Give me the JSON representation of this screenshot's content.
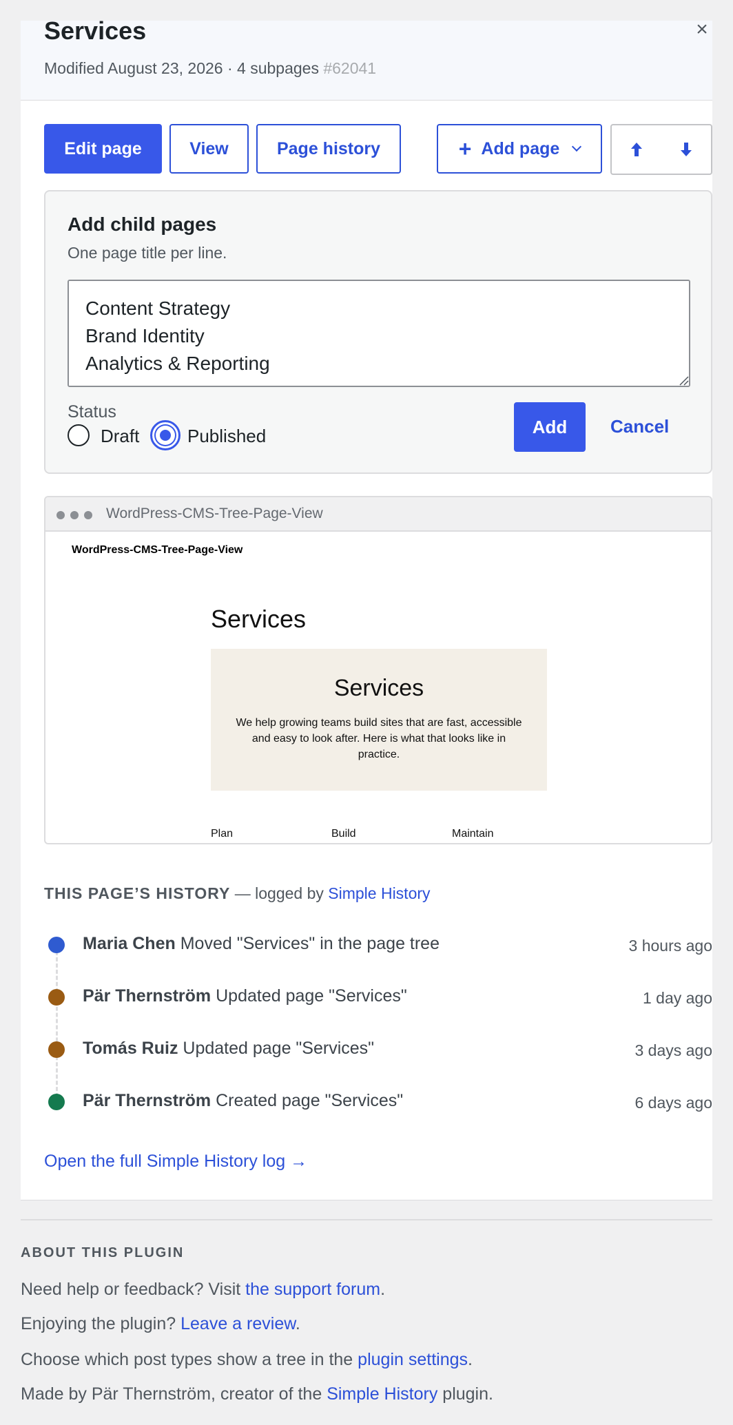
{
  "header": {
    "title": "Services",
    "meta": "Modified August 23, 2026 · 4 subpages",
    "page_id": "#62041",
    "close_glyph": "×"
  },
  "toolbar": {
    "edit_label": "Edit page",
    "view_label": "View",
    "history_label": "Page history",
    "add_plus": "+",
    "add_label": "Add page",
    "move_up_glyph": "🡅",
    "move_down_glyph": "🡇"
  },
  "add_child": {
    "title": "Add child pages",
    "hint": "One page title per line.",
    "textarea_value": "Content Strategy\nBrand Identity\nAnalytics & Reporting",
    "status_label": "Status",
    "options": [
      "Draft",
      "Published"
    ],
    "selected": "Published",
    "add_label": "Add",
    "cancel_label": "Cancel"
  },
  "preview": {
    "window_title": "WordPress-CMS-Tree-Page-View",
    "site_name": "WordPress-CMS-Tree-Page-View",
    "heading": "Services",
    "hero_title": "Services",
    "hero_text": "We help growing teams build sites that are fast, accessible and easy to look after. Here is what that looks like in practice.",
    "columns": [
      "Plan",
      "Build",
      "Maintain"
    ]
  },
  "history": {
    "heading_caps": "THIS PAGE’S HISTORY",
    "heading_rest": " — logged by ",
    "heading_link": "Simple History",
    "items": [
      {
        "user": "Maria Chen",
        "action": " Moved \"Services\" in the page tree",
        "time": "3 hours ago",
        "color": "#2f5bd0"
      },
      {
        "user": "Pär Thernström",
        "action": " Updated page \"Services\"",
        "time": "1 day ago",
        "color": "#9a5b13"
      },
      {
        "user": "Tomás Ruiz",
        "action": " Updated page \"Services\"",
        "time": "3 days ago",
        "color": "#9a5b13"
      },
      {
        "user": "Pär Thernström",
        "action": " Created page \"Services\"",
        "time": "6 days ago",
        "color": "#157a4f"
      }
    ],
    "full_log_link": "Open the full Simple History log →"
  },
  "about": {
    "heading": "ABOUT THIS PLUGIN",
    "line1_text": "Need help or feedback? Visit ",
    "line1_link": "the support forum",
    "line1_end": ".",
    "line2_text": "Enjoying the plugin? ",
    "line2_link": "Leave a review",
    "line2_end": ".",
    "line3_text": "Choose which post types show a tree in the ",
    "line3_link": "plugin settings",
    "line3_end": ".",
    "line4_text": "Made by Pär Thernström, creator of the ",
    "line4_link": "Simple History",
    "line4_end": " plugin."
  },
  "colors": {
    "accent": "#3858e9",
    "link": "#2c50d8",
    "header_bg": "#f6f8fc",
    "page_bg": "#f0f0f1"
  }
}
